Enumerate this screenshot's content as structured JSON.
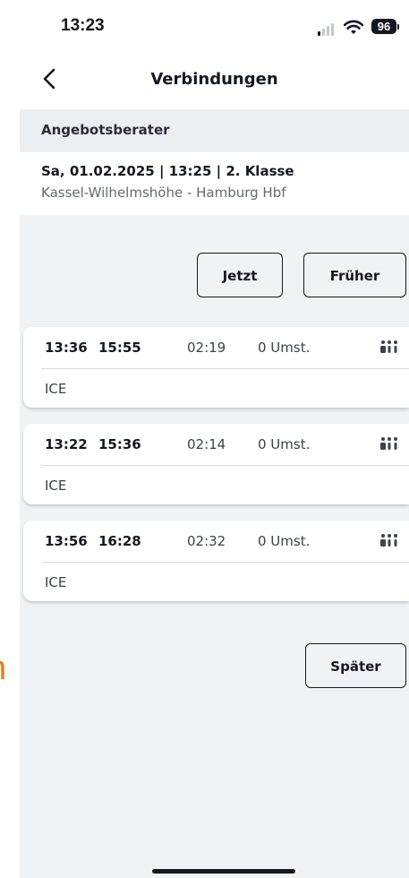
{
  "status_bar": {
    "time": "13:23",
    "battery": "96"
  },
  "header": {
    "title": "Verbindungen",
    "back_icon": "chevron-left-icon"
  },
  "section": {
    "title": "Angebotsberater"
  },
  "search_summary": {
    "line1": "Sa, 01.02.2025 | 13:25 | 2. Klasse",
    "line2": "Kassel-Wilhelmshöhe - Hamburg Hbf"
  },
  "buttons": {
    "now": "Jetzt",
    "earlier": "Früher",
    "later": "Später"
  },
  "connections": [
    {
      "departure": "13:36",
      "arrival": "15:55",
      "duration": "02:19",
      "changes": "0 Umst.",
      "product": "ICE",
      "occupancy_icon": "occupancy-icon"
    },
    {
      "departure": "13:22",
      "arrival": "15:36",
      "duration": "02:14",
      "changes": "0 Umst.",
      "product": "ICE",
      "occupancy_icon": "occupancy-icon"
    },
    {
      "departure": "13:56",
      "arrival": "16:28",
      "duration": "02:32",
      "changes": "0 Umst.",
      "product": "ICE",
      "occupancy_icon": "occupancy-icon"
    }
  ],
  "background_char": "n",
  "colors": {
    "accent_orange": "#ec7a1c",
    "text": "#131821",
    "background": "#f0f3f5"
  }
}
